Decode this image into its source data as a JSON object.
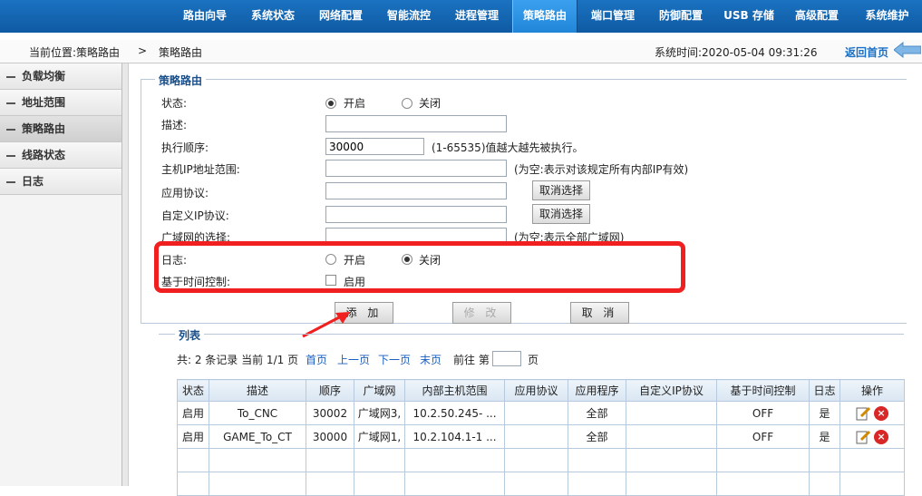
{
  "nav": {
    "tabs": [
      "路由向导",
      "系统状态",
      "网络配置",
      "智能流控",
      "进程管理",
      "策略路由",
      "端口管理",
      "防御配置",
      "USB 存储",
      "高级配置",
      "系统维护"
    ],
    "active": "策略路由"
  },
  "breadcrumb": {
    "location_label": "当前位置:策略路由",
    "separator": ">",
    "current": "策略路由",
    "system_time": "系统时间:2020-05-04 09:31:26",
    "home_link": "返回首页"
  },
  "sidebar": {
    "items": [
      {
        "label": "负载均衡",
        "active": false
      },
      {
        "label": "地址范围",
        "active": false
      },
      {
        "label": "策略路由",
        "active": true
      },
      {
        "label": "线路状态",
        "active": false
      },
      {
        "label": "日志",
        "active": false
      }
    ]
  },
  "form": {
    "legend": "策略路由",
    "status_label": "状态:",
    "status_on": "开启",
    "status_off": "关闭",
    "desc_label": "描述:",
    "desc_value": "",
    "order_label": "执行顺序:",
    "order_value": "30000",
    "order_hint": "(1-65535)值越大越先被执行。",
    "host_range_label": "主机IP地址范围:",
    "host_range_value": "",
    "host_range_hint": "(为空:表示对该规定所有内部IP有效)",
    "app_protocol_label": "应用协议:",
    "app_protocol_value": "",
    "cancel_select_1": "取消选择",
    "custom_ip_label": "自定义IP协议:",
    "custom_ip_value": "",
    "cancel_select_2": "取消选择",
    "wan_label": "广域网的选择:",
    "wan_value": "",
    "wan_hint": "(为空:表示全部广域网)",
    "log_label": "日志:",
    "log_on": "开启",
    "log_off": "关闭",
    "time_ctrl_label": "基于时间控制:",
    "time_ctrl_option": "启用",
    "add_btn": "添 加",
    "modify_btn": "修 改",
    "cancel_btn": "取 消"
  },
  "list": {
    "legend": "列表",
    "summary": "共: 2 条记录 当前 1/1 页",
    "first": "首页",
    "prev": "上一页",
    "next": "下一页",
    "last": "末页",
    "goto": "前往 第",
    "page_suffix": "页",
    "page_input": "",
    "columns": [
      "状态",
      "描述",
      "顺序",
      "广域网",
      "内部主机范围",
      "应用协议",
      "应用程序",
      "自定义IP协议",
      "基于时间控制",
      "日志",
      "操作"
    ],
    "rows": [
      [
        "启用",
        "To_CNC",
        "30002",
        "广域网3,",
        "10.2.50.245- ...",
        "",
        "全部",
        "",
        "OFF",
        "是"
      ],
      [
        "启用",
        "GAME_To_CT",
        "30000",
        "广域网1,",
        "10.2.104.1-1 ...",
        "",
        "全部",
        "",
        "OFF",
        "是"
      ]
    ]
  },
  "colors": {
    "nav_bg": "#0f5aa3",
    "nav_active": "#2186d8",
    "highlight": "#f02020",
    "link": "#1a5fc0"
  }
}
